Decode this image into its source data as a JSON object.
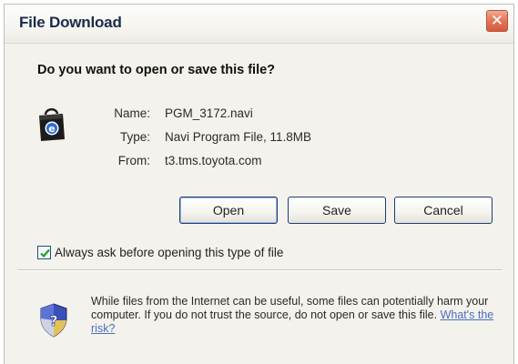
{
  "window": {
    "title": "File Download",
    "close_glyph": "✕"
  },
  "dialog": {
    "question": "Do you want to open or save this file?",
    "file": {
      "icon": "file-download-icon",
      "name_label": "Name:",
      "name_value": "PGM_3172.navi",
      "type_label": "Type:",
      "type_value": "Navi Program File, 11.8MB",
      "from_label": "From:",
      "from_value": "t3.tms.toyota.com"
    },
    "buttons": {
      "open": "Open",
      "save": "Save",
      "cancel": "Cancel"
    },
    "always_ask": {
      "checked": true,
      "label": "Always ask before opening this type of file"
    },
    "warning": {
      "icon": "shield-question-icon",
      "text": "While files from the Internet can be useful, some files can potentially harm your computer. If you do not trust the source, do not open or save this file. ",
      "link_text": "What's the risk?"
    }
  },
  "colors": {
    "title_text": "#1b2a4a",
    "close_button": "#d65a3e",
    "button_border": "#1f3c74",
    "link": "#4a6fc1",
    "dialog_background": "#f3f2ec"
  }
}
